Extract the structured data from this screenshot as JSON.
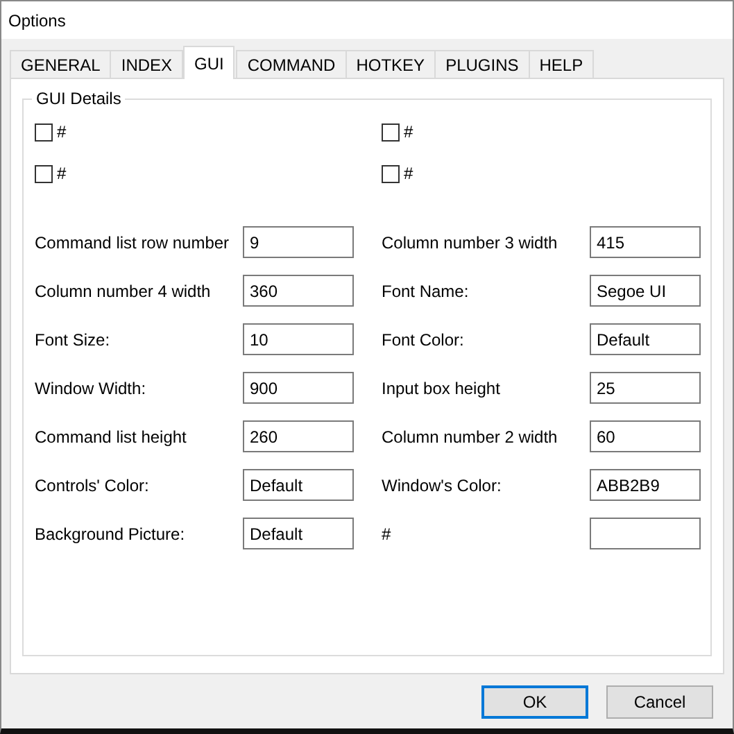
{
  "window": {
    "title": "Options"
  },
  "tabs": [
    {
      "label": "GENERAL",
      "selected": false
    },
    {
      "label": "INDEX",
      "selected": false
    },
    {
      "label": "GUI",
      "selected": true
    },
    {
      "label": "COMMAND",
      "selected": false
    },
    {
      "label": "HOTKEY",
      "selected": false
    },
    {
      "label": "PLUGINS",
      "selected": false
    },
    {
      "label": "HELP",
      "selected": false
    }
  ],
  "group": {
    "title": "GUI Details"
  },
  "checkboxes": [
    {
      "label": "#",
      "checked": false
    },
    {
      "label": "#",
      "checked": false
    },
    {
      "label": "#",
      "checked": false
    },
    {
      "label": "#",
      "checked": false
    }
  ],
  "fields": [
    {
      "label": "Command list row number",
      "value": "9"
    },
    {
      "label": "Column number 3 width",
      "value": "415"
    },
    {
      "label": "Column number 4 width",
      "value": "360"
    },
    {
      "label": "Font Name:",
      "value": "Segoe UI"
    },
    {
      "label": "Font Size:",
      "value": "10"
    },
    {
      "label": "Font Color:",
      "value": "Default"
    },
    {
      "label": "Window Width:",
      "value": "900"
    },
    {
      "label": "Input box height",
      "value": "25"
    },
    {
      "label": "Command list height",
      "value": "260"
    },
    {
      "label": "Column number 2 width",
      "value": "60"
    },
    {
      "label": "Controls' Color:",
      "value": "Default"
    },
    {
      "label": "Window's Color:",
      "value": "ABB2B9"
    },
    {
      "label": "Background Picture:",
      "value": "Default"
    },
    {
      "label": "#"
    }
  ],
  "buttons": [
    {
      "label": "OK",
      "default": true
    },
    {
      "label": "Cancel",
      "default": false
    }
  ]
}
